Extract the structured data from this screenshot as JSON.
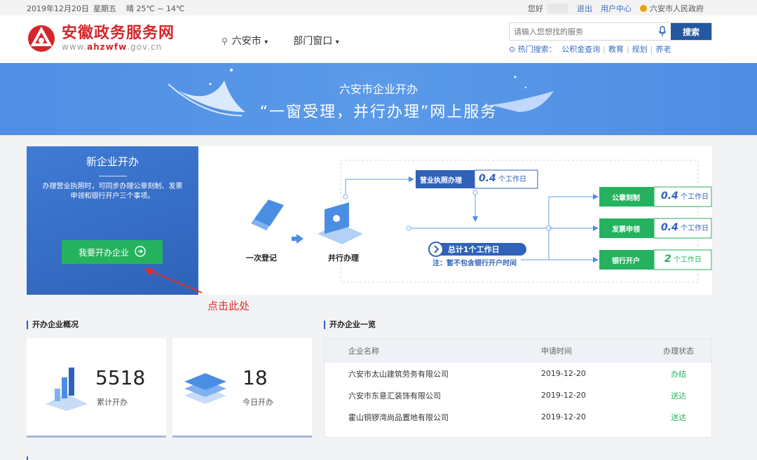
{
  "topbar": {
    "date": "2019年12月20日",
    "weekday": "星期五",
    "weather": "晴 25℃ ~ 14℃",
    "greeting": "您好",
    "logout": "退出",
    "user_center": "用户中心",
    "gov_link": "六安市人民政府"
  },
  "header": {
    "logo_title": "安徽政务服务网",
    "logo_url_prefix": "www.",
    "logo_url_brand": "ahzwfw",
    "logo_url_suffix": ".gov.cn",
    "location": "六安市",
    "location_caret": "▾",
    "department": "部门窗口",
    "department_caret": "▾",
    "search_placeholder": "请输入您想找的服务",
    "search_button": "搜索",
    "hot_label": "热门搜索：",
    "hot_items": [
      "公积金查询",
      "教育",
      "规划",
      "养老"
    ],
    "hot_sep": "|"
  },
  "banner": {
    "line1": "六安市企业开办",
    "line2": "“一窗受理，并行办理”网上服务"
  },
  "new_company": {
    "title": "新企业开办",
    "description": "办理营业执照时，可同步办理公章刻制、发票申领和银行开户三个事项。",
    "button": "我要开办企业"
  },
  "flow": {
    "step1": "一次登记",
    "step2": "并行办理",
    "license": "营业执照办理",
    "license_value": "0.4",
    "unit": "个工作日",
    "total": "总计1个工作日",
    "note": "注：暂不包含银行开户时间",
    "seal": "公章刻制",
    "seal_value": "0.4",
    "invoice": "发票申领",
    "invoice_value": "0.4",
    "bank": "银行开户",
    "bank_value": "2"
  },
  "annotation": "点击此处",
  "overview": {
    "title": "开办企业概况",
    "total_value": "5518",
    "total_label": "累计开办",
    "today_value": "18",
    "today_label": "今日开办"
  },
  "company_list": {
    "title": "开办企业一览",
    "headers": [
      "企业名称",
      "申请时间",
      "办理状态"
    ],
    "rows": [
      {
        "name": "六安市太山建筑劳务有限公司",
        "date": "2019-12-20",
        "status": "办结"
      },
      {
        "name": "六安市东意汇装饰有限公司",
        "date": "2019-12-20",
        "status": "送达"
      },
      {
        "name": "霍山铜锣湾尚品置地有限公司",
        "date": "2019-12-20",
        "status": "送达"
      }
    ]
  },
  "colors": {
    "brand_red": "#d6252b",
    "primary_blue": "#2f62b8",
    "green": "#25b25e",
    "annotation_red": "#e0302a"
  }
}
